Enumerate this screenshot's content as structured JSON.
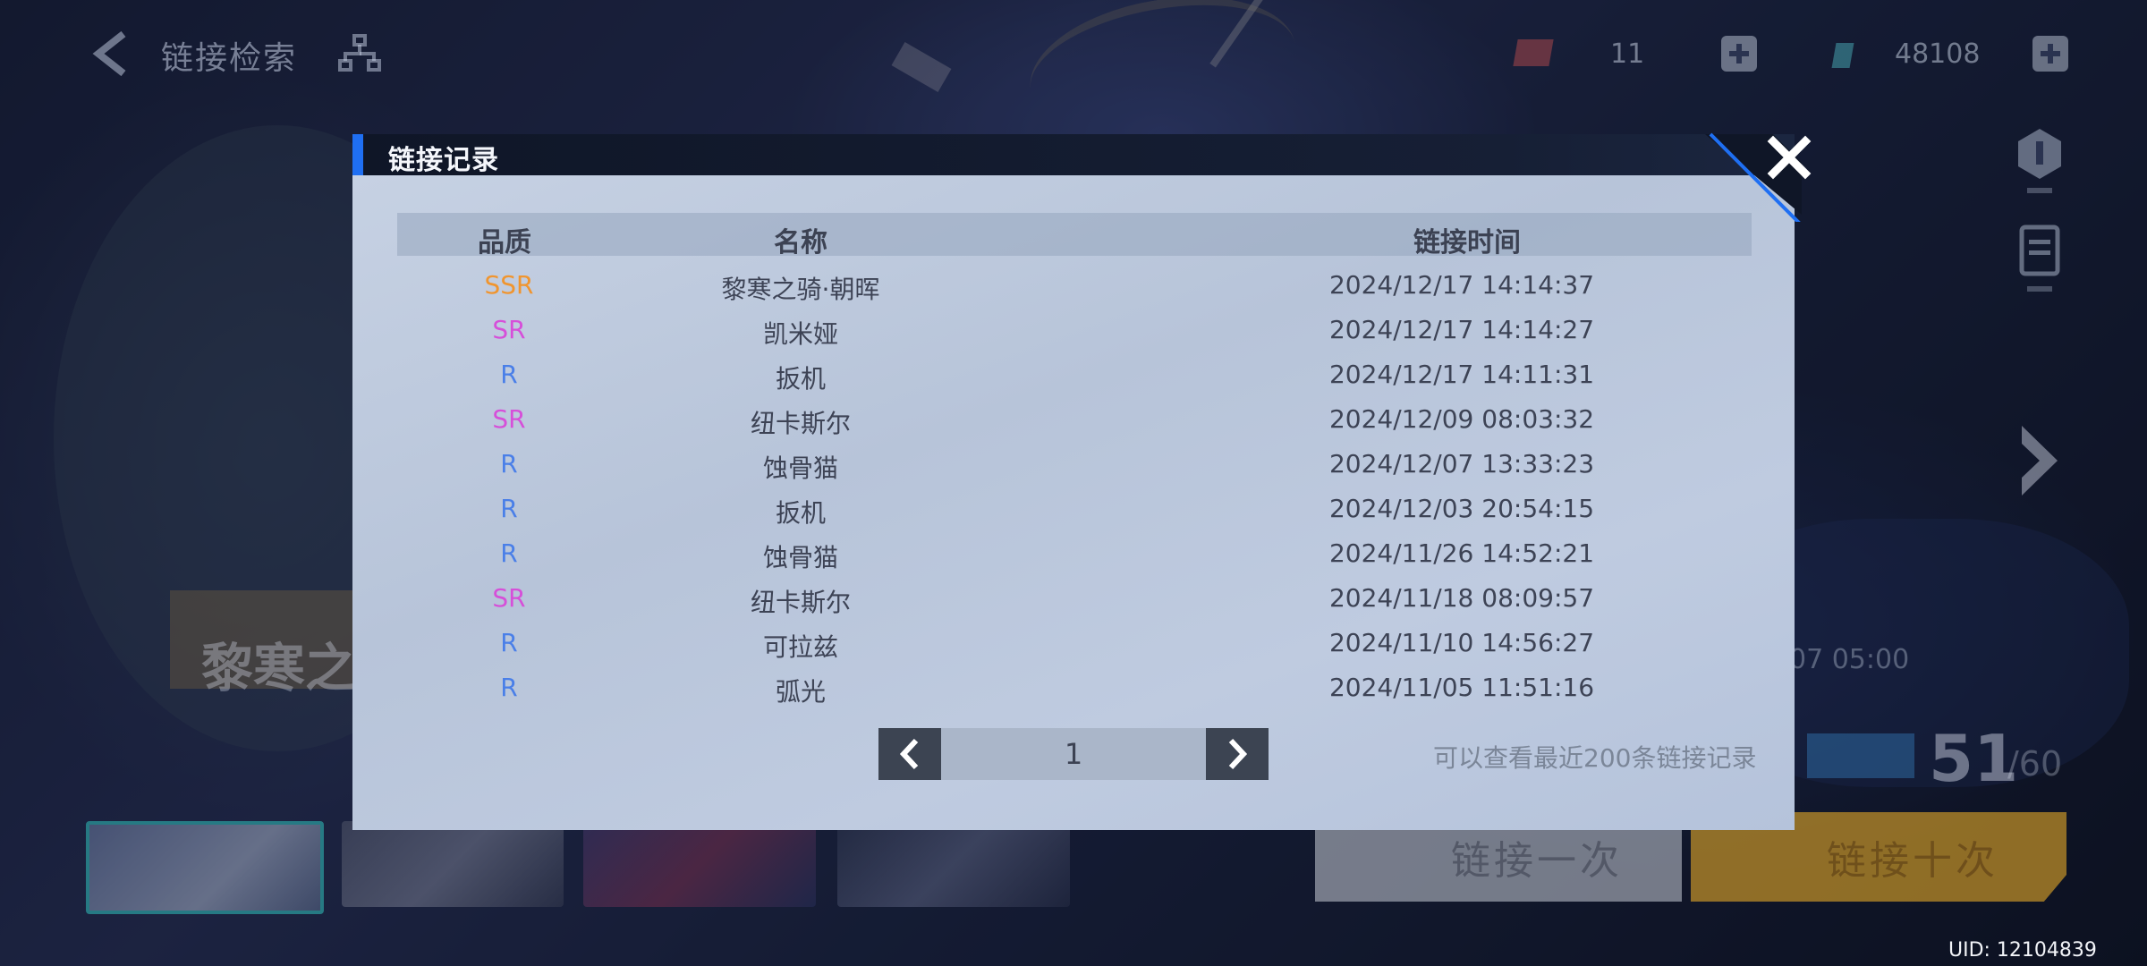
{
  "topbar": {
    "title": "链接检索",
    "resource1_value": "11",
    "resource2_value": "48108"
  },
  "banner": {
    "name": "黎寒之",
    "date": "07 05:00",
    "count": "51",
    "count_max": "/60"
  },
  "buttons": {
    "single": "链接一次",
    "ten": "链接十次"
  },
  "uid": "UID:  12104839",
  "modal": {
    "title": "链接记录",
    "headers": {
      "quality": "品质",
      "name": "名称",
      "time": "链接时间"
    },
    "rows": [
      {
        "quality": "SSR",
        "name": "黎寒之骑·朝晖",
        "time": "2024/12/17 14:14:37"
      },
      {
        "quality": "SR",
        "name": "凯米娅",
        "time": "2024/12/17 14:14:27"
      },
      {
        "quality": "R",
        "name": "扳机",
        "time": "2024/12/17 14:11:31"
      },
      {
        "quality": "SR",
        "name": "纽卡斯尔",
        "time": "2024/12/09 08:03:32"
      },
      {
        "quality": "R",
        "name": "蚀骨猫",
        "time": "2024/12/07 13:33:23"
      },
      {
        "quality": "R",
        "name": "扳机",
        "time": "2024/12/03 20:54:15"
      },
      {
        "quality": "R",
        "name": "蚀骨猫",
        "time": "2024/11/26 14:52:21"
      },
      {
        "quality": "SR",
        "name": "纽卡斯尔",
        "time": "2024/11/18 08:09:57"
      },
      {
        "quality": "R",
        "name": "可拉兹",
        "time": "2024/11/10 14:56:27"
      },
      {
        "quality": "R",
        "name": "弧光",
        "time": "2024/11/05 11:51:16"
      }
    ],
    "page": "1",
    "note": "可以查看最近200条链接记录"
  },
  "colors": {
    "SSR": "#f0952f",
    "SR": "#d64fd9",
    "R": "#4a7fe8",
    "accent": "#1f6ff2"
  },
  "icons": {
    "back": "chevron-left-icon",
    "tree": "hierarchy-icon",
    "close": "close-icon",
    "prev": "chevron-left-icon",
    "next": "chevron-right-icon"
  }
}
